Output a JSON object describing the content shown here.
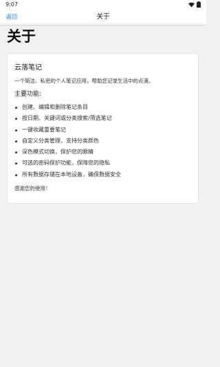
{
  "status_bar": {
    "time": "9:07",
    "icons": [
      "wifi-icon",
      "battery-icon"
    ]
  },
  "nav": {
    "back_label": "返回",
    "title": "关于"
  },
  "page": {
    "heading": "关于"
  },
  "card": {
    "app_name": "云落笔记",
    "description": "一个简洁、私密的个人笔记应用，帮助您记录生活中的点滴。",
    "features_heading": "主要功能:",
    "features": [
      "创建、编辑和删除笔记条目",
      "按日期、关键词或分类搜索/筛选笔记",
      "一键收藏重要笔记",
      "自定义分类管理，支持分类颜色",
      "深色模式切换，保护您的眼睛",
      "可选的密码保护功能，保障您的隐私",
      "所有数据存储在本地设备，确保数据安全"
    ],
    "thanks": "感谢您的使用！"
  },
  "colors": {
    "accent": "#1a73e8",
    "background": "#f2f2f2",
    "card": "#ffffff"
  }
}
